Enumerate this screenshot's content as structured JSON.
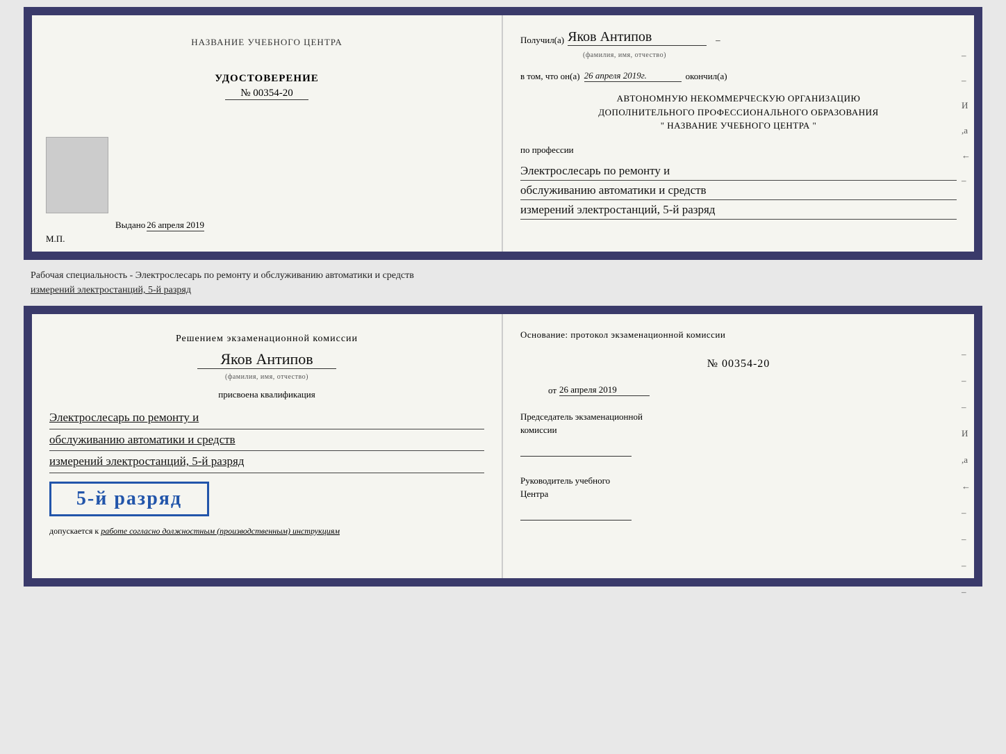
{
  "doc1": {
    "left": {
      "center_title": "НАЗВАНИЕ УЧЕБНОГО ЦЕНТРА",
      "udostoverenie_label": "УДОСТОВЕРЕНИЕ",
      "udostoverenie_num": "№ 00354-20",
      "vydano_label": "Выдано",
      "vydano_date": "26 апреля 2019",
      "mp_label": "М.П."
    },
    "right": {
      "poluchil_label": "Получил(а)",
      "poluchil_name": "Яков Антипов",
      "fio_hint": "(фамилия, имя, отчество)",
      "dash": "–",
      "vtom_label": "в том, что он(а)",
      "vtom_date": "26 апреля 2019г.",
      "okonchil_label": "окончил(а)",
      "org_line1": "АВТОНОМНУЮ НЕКОММЕРЧЕСКУЮ ОРГАНИЗАЦИЮ",
      "org_line2": "ДОПОЛНИТЕЛЬНОГО ПРОФЕССИОНАЛЬНОГО ОБРАЗОВАНИЯ",
      "org_name": "\"  НАЗВАНИЕ УЧЕБНОГО ЦЕНТРА  \"",
      "po_professii": "по профессии",
      "prof_line1": "Электрослесарь по ремонту и",
      "prof_line2": "обслуживанию автоматики и средств",
      "prof_line3": "измерений электростанций, 5-й разряд"
    }
  },
  "specialty_text": "Рабочая специальность - Электрослесарь по ремонту и обслуживанию автоматики и средств",
  "specialty_text2": "измерений электростанций, 5-й разряд",
  "doc2": {
    "left": {
      "reshenie_line1": "Решением  экзаменационной  комиссии",
      "name": "Яков Антипов",
      "fio_hint": "(фамилия, имя, отчество)",
      "prisvoena": "присвоена квалификация",
      "qual_line1": "Электрослесарь по ремонту и",
      "qual_line2": "обслуживанию автоматики и средств",
      "qual_line3": "измерений электростанций, 5-й разряд",
      "razryad_badge": "5-й разряд",
      "dopuskaetsya": "допускается к",
      "dopusk_text": "работе согласно должностным (производственным) инструкциям"
    },
    "right": {
      "osnovanie_label": "Основание: протокол экзаменационной комиссии",
      "num_label": "№  00354-20",
      "ot_label": "от",
      "ot_date": "26 апреля 2019",
      "predsedatel_line1": "Председатель экзаменационной",
      "predsedatel_line2": "комиссии",
      "rukovoditel_line1": "Руководитель учебного",
      "rukovoditel_line2": "Центра"
    }
  },
  "side_marks": {
    "marks": [
      "–",
      "–",
      "И",
      ",а",
      "←",
      "–",
      "–",
      "–",
      "–"
    ]
  }
}
